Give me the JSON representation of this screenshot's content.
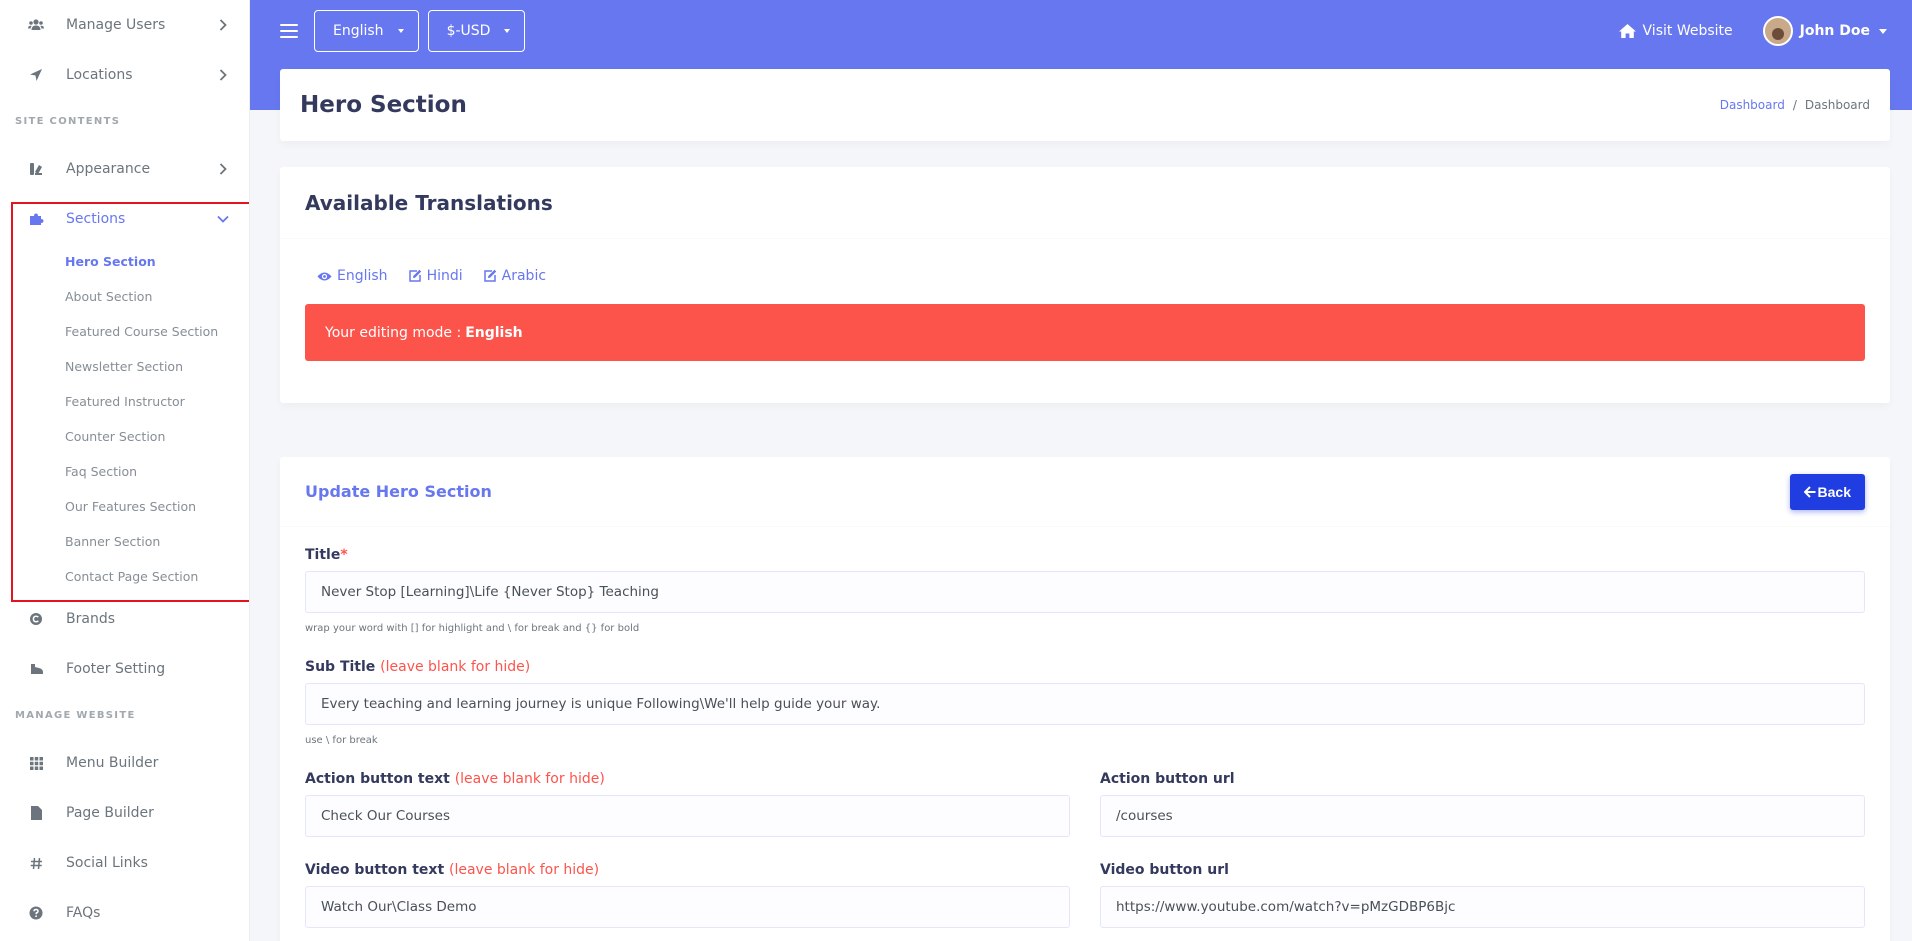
{
  "sidebar": {
    "top_items": [
      {
        "label": "Manage Users",
        "icon": "users-icon"
      },
      {
        "label": "Locations",
        "icon": "location-arrow-icon"
      }
    ],
    "site_contents_header": "SITE CONTENTS",
    "appearance": {
      "label": "Appearance",
      "icon": "paint-icon"
    },
    "sections": {
      "label": "Sections",
      "icon": "puzzle-icon",
      "submenu": [
        "Hero Section",
        "About Section",
        "Featured Course Section",
        "Newsletter Section",
        "Featured Instructor",
        "Counter Section",
        "Faq Section",
        "Our Features Section",
        "Banner Section",
        "Contact Page Section"
      ]
    },
    "brands": {
      "label": "Brands",
      "icon": "copyright-icon"
    },
    "footer": {
      "label": "Footer Setting",
      "icon": "shoe-icon"
    },
    "manage_website_header": "MANAGE WEBSITE",
    "bottom_items": [
      {
        "label": "Menu Builder",
        "icon": "grid-icon"
      },
      {
        "label": "Page Builder",
        "icon": "file-icon"
      },
      {
        "label": "Social Links",
        "icon": "hashtag-icon"
      },
      {
        "label": "FAQs",
        "icon": "question-circle-icon"
      }
    ]
  },
  "navbar": {
    "language": "English",
    "currency": "$-USD",
    "visit_website": "Visit Website",
    "user_name": "John Doe"
  },
  "page": {
    "title": "Hero Section",
    "breadcrumb": {
      "link": "Dashboard",
      "sep": "/",
      "current": "Dashboard"
    }
  },
  "translations": {
    "title": "Available Translations",
    "links": [
      {
        "label": "English",
        "icon": "eye-icon"
      },
      {
        "label": "Hindi",
        "icon": "edit-icon"
      },
      {
        "label": "Arabic",
        "icon": "edit-icon"
      }
    ],
    "alert_prefix": "Your editing mode :",
    "alert_lang": "English"
  },
  "form": {
    "title": "Update Hero Section",
    "back_label": "Back",
    "title_field": {
      "label": "Title",
      "required": "*",
      "value": "Never Stop [Learning]\\Life {Never Stop} Teaching",
      "help": "wrap your word with [] for highlight and \\ for break and {} for bold"
    },
    "subtitle_field": {
      "label": "Sub Title",
      "hint": "(leave blank for hide)",
      "value": "Every teaching and learning journey is unique Following\\We'll help guide your way.",
      "help": "use \\ for break"
    },
    "action_text": {
      "label": "Action button text",
      "hint": "(leave blank for hide)",
      "value": "Check Our Courses"
    },
    "action_url": {
      "label": "Action button url",
      "value": "/courses"
    },
    "video_text": {
      "label": "Video button text",
      "hint": "(leave blank for hide)",
      "value": "Watch Our\\Class Demo"
    },
    "video_url": {
      "label": "Video button url",
      "value": "https://www.youtube.com/watch?v=pMzGDBP6Bjc"
    }
  },
  "colors": {
    "primary": "#6777ef",
    "danger": "#fc544b",
    "back_button": "#1f3de0",
    "highlight_border": "#e3131f"
  }
}
